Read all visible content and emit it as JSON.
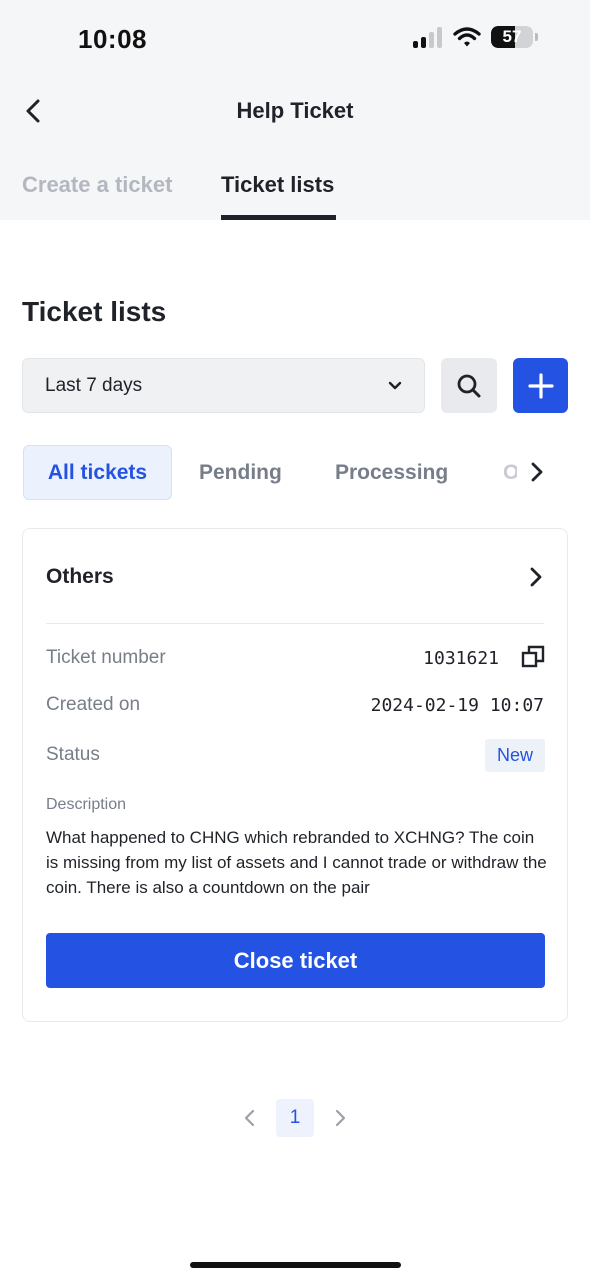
{
  "status_bar": {
    "time": "10:08",
    "battery_percent": "57",
    "battery_level": 0.57,
    "icons": [
      "signal-icon",
      "wifi-icon",
      "battery-icon"
    ]
  },
  "header": {
    "title": "Help Ticket",
    "back_icon": "chevron-left-icon"
  },
  "top_tabs": [
    {
      "label": "Create a ticket",
      "active": false
    },
    {
      "label": "Ticket lists",
      "active": true
    }
  ],
  "section_title": "Ticket lists",
  "filters": {
    "date_range": "Last 7 days",
    "date_icon": "chevron-down-icon",
    "search_icon": "search-icon",
    "add_icon": "plus-icon"
  },
  "status_tabs": [
    {
      "label": "All tickets",
      "active": true
    },
    {
      "label": "Pending",
      "active": false
    },
    {
      "label": "Processing",
      "active": false
    },
    {
      "label": "O",
      "active": false
    }
  ],
  "ticket": {
    "category": "Others",
    "number_label": "Ticket number",
    "number_value": "1031621",
    "created_label": "Created on",
    "created_value": "2024-02-19 10:07",
    "status_label": "Status",
    "status_value": "New",
    "description_label": "Description",
    "description_text": "What happened to CHNG which rebranded to XCHNG? The coin is missing from my list of assets and I cannot trade or withdraw the coin. There is also a countdown on the pair",
    "close_button": "Close ticket"
  },
  "pagination": {
    "current_page": "1"
  },
  "colors": {
    "accent": "#2453e3",
    "top_background": "#f5f6f8",
    "muted_text": "#777e8a"
  }
}
